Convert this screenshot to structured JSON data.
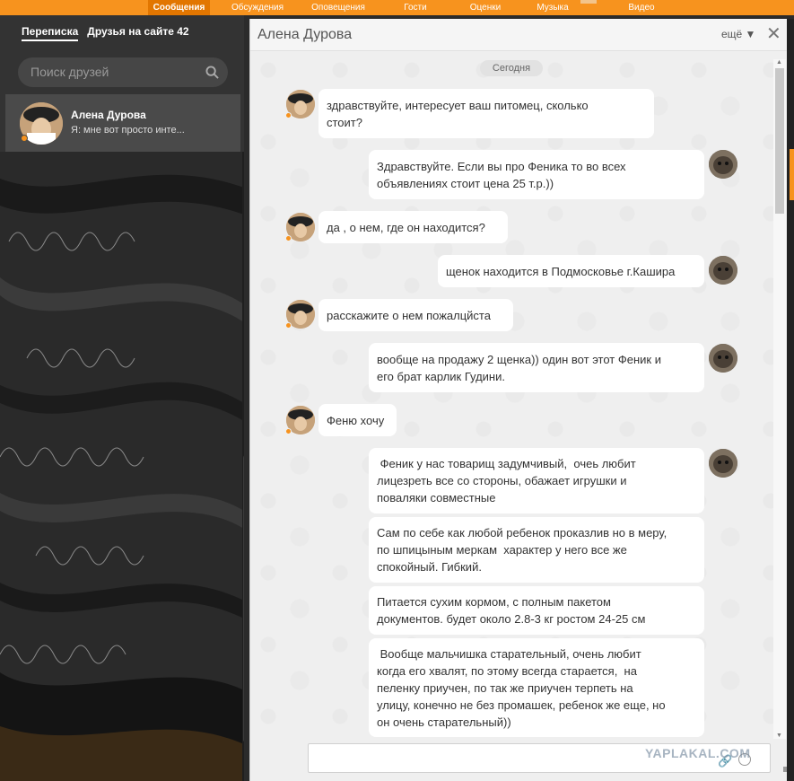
{
  "nav": {
    "tabs": [
      {
        "label": "Сообщения",
        "active": true
      },
      {
        "label": "Обсуждения",
        "active": false
      },
      {
        "label": "Оповещения",
        "active": false
      },
      {
        "label": "Гости",
        "active": false
      },
      {
        "label": "Оценки",
        "active": false
      },
      {
        "label": "Музыка",
        "active": false
      },
      {
        "label": "Видео",
        "active": false
      }
    ],
    "accent": "#f7931e"
  },
  "sidebar": {
    "tab_messages": "Переписка",
    "tab_friends": "Друзья на сайте 42",
    "search_placeholder": "Поиск друзей",
    "contact": {
      "name": "Алена Дурова",
      "preview": "Я: мне вот просто инте...",
      "online": true
    }
  },
  "chat": {
    "title": "Алена Дурова",
    "more_label": "ещё ▼",
    "close_label": "✕",
    "date_label": "Сегодня",
    "messages": [
      {
        "side": "in",
        "lines": [
          "здравствуйте, интересует ваш питомец, сколько",
          "стоит?"
        ]
      },
      {
        "side": "out",
        "lines": [
          "Здравствуйте. Если вы про Феника то во всех",
          "объявлениях стоит цена 25 т.р.))"
        ]
      },
      {
        "side": "in",
        "lines": [
          "да , о нем, где он находится?"
        ]
      },
      {
        "side": "out",
        "lines": [
          "щенок находится в Подмосковье г.Кашира"
        ]
      },
      {
        "side": "in",
        "lines": [
          "расскажите о нем пожалцйста"
        ]
      },
      {
        "side": "out",
        "lines": [
          "вообще на продажу 2 щенка)) один вот этот Феник и",
          "его брат карлик Гудини."
        ]
      },
      {
        "side": "in",
        "lines": [
          "Феню хочу"
        ]
      },
      {
        "side": "out",
        "lines": [
          " Феник у нас товарищ задумчивый,  очеь любит",
          "лицезреть все со стороны, обажает игрушки и",
          "поваляки совместные"
        ]
      },
      {
        "side": "out",
        "lines": [
          "Сам по себе как любой ребенок проказлив но в меру,",
          "по шпицыным меркам  характер у него все же",
          "спокойный. Гибкий."
        ]
      },
      {
        "side": "out",
        "lines": [
          "Питается сухим кормом, с полным пакетом",
          "документов. будет около 2.8-3 кг ростом 24-25 см"
        ]
      },
      {
        "side": "out",
        "lines": [
          " Вообще мальчишка старательный, очень любит",
          "когда его хвалят, по этому всегда старается,  на",
          "пеленку приучен, по так же приучен терпеть на",
          "улицу, конечно не без промашек, ребенок же еще, но",
          "он очень старательный))"
        ]
      }
    ],
    "composer_value": "",
    "watermark": "YAPLAKAL.COM"
  }
}
